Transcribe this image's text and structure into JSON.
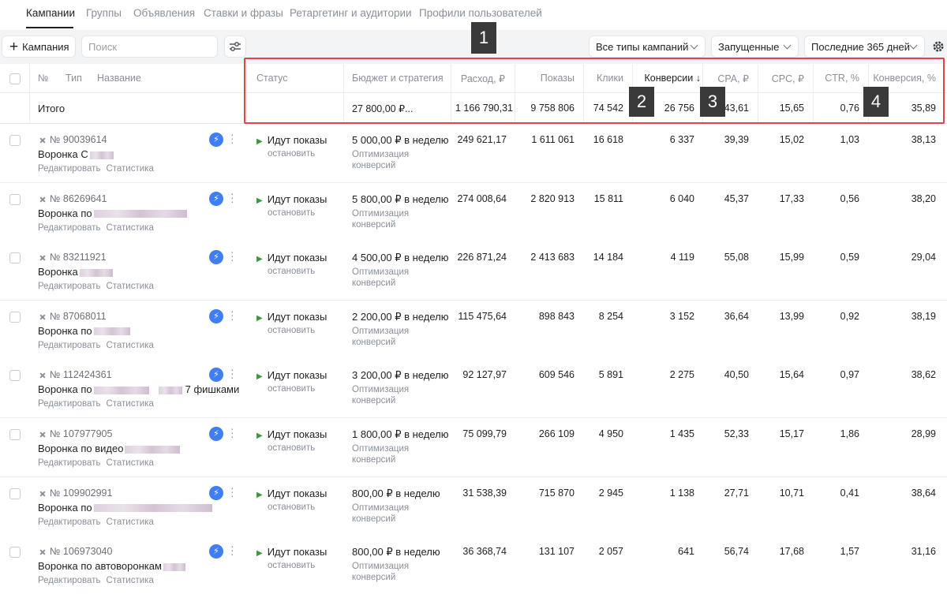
{
  "tabs": [
    "Кампании",
    "Группы",
    "Объявления",
    "Ставки и фразы",
    "Ретаргетинг и аудитории",
    "Профили пользователей"
  ],
  "toolbar": {
    "add_label": "Кампания",
    "search_placeholder": "Поиск",
    "filter_types": "Все типы кампаний",
    "filter_state": "Запущенные",
    "filter_period": "Последние 365 дней"
  },
  "headers": {
    "num": "№",
    "type": "Тип",
    "name": "Название",
    "status": "Статус",
    "budget": "Бюджет и стратегия",
    "spend": "Расход, ₽",
    "impressions": "Показы",
    "clicks": "Клики",
    "conversions": "Конверсии ↓",
    "cpa": "CPA, ₽",
    "cpc": "CPC, ₽",
    "ctr": "CTR, %",
    "conv_rate": "Конверсия, %"
  },
  "total": {
    "label": "Итого",
    "budget": "27 800,00 ₽...",
    "spend": "1 166 790,31",
    "impressions": "9 758 806",
    "clicks": "74 542",
    "conversions": "26 756",
    "cpa": "43,61",
    "cpc": "15,65",
    "ctr": "0,76",
    "conv_rate": "35,89"
  },
  "row_common": {
    "edit": "Редактировать",
    "stats": "Статистика",
    "status": "Идут показы",
    "stop": "остановить",
    "strategy_1": "Оптимизация",
    "strategy_2": "конверсий"
  },
  "rows": [
    {
      "id": "№ 90039614",
      "name": "Воронка С",
      "name_suffix": "",
      "budget": "5 000,00 ₽ в неделю",
      "spend": "249 621,17",
      "impressions": "1 611 061",
      "clicks": "16 618",
      "conversions": "6 337",
      "cpa": "39,39",
      "cpc": "15,02",
      "ctr": "1,03",
      "conv_rate": "38,13"
    },
    {
      "id": "№ 86269641",
      "name": "Воронка по",
      "name_suffix": "",
      "budget": "5 800,00 ₽ в неделю",
      "spend": "274 008,64",
      "impressions": "2 820 913",
      "clicks": "15 811",
      "conversions": "6 040",
      "cpa": "45,37",
      "cpc": "17,33",
      "ctr": "0,56",
      "conv_rate": "38,20"
    },
    {
      "id": "№ 83211921",
      "name": "Воронка",
      "name_suffix": "",
      "budget": "4 500,00 ₽ в неделю",
      "spend": "226 871,24",
      "impressions": "2 413 683",
      "clicks": "14 184",
      "conversions": "4 119",
      "cpa": "55,08",
      "cpc": "15,99",
      "ctr": "0,59",
      "conv_rate": "29,04"
    },
    {
      "id": "№ 87068011",
      "name": "Воронка по",
      "name_suffix": "",
      "budget": "2 200,00 ₽ в неделю",
      "spend": "115 475,64",
      "impressions": "898 843",
      "clicks": "8 254",
      "conversions": "3 152",
      "cpa": "36,64",
      "cpc": "13,99",
      "ctr": "0,92",
      "conv_rate": "38,19"
    },
    {
      "id": "№ 112424361",
      "name": "Воронка по",
      "name_suffix": "7 фишками",
      "budget": "3 200,00 ₽ в неделю",
      "spend": "92 127,97",
      "impressions": "609 546",
      "clicks": "5 891",
      "conversions": "2 275",
      "cpa": "40,50",
      "cpc": "15,64",
      "ctr": "0,97",
      "conv_rate": "38,62"
    },
    {
      "id": "№ 107977905",
      "name": "Воронка по видео",
      "name_suffix": "",
      "budget": "1 800,00 ₽ в неделю",
      "spend": "75 099,79",
      "impressions": "266 109",
      "clicks": "4 950",
      "conversions": "1 435",
      "cpa": "52,33",
      "cpc": "15,17",
      "ctr": "1,86",
      "conv_rate": "28,99"
    },
    {
      "id": "№ 109902991",
      "name": "Воронка по",
      "name_suffix": "",
      "budget": "800,00 ₽ в неделю",
      "spend": "31 538,39",
      "impressions": "715 870",
      "clicks": "2 945",
      "conversions": "1 138",
      "cpa": "27,71",
      "cpc": "10,71",
      "ctr": "0,41",
      "conv_rate": "38,64"
    },
    {
      "id": "№ 106973040",
      "name": "Воронка по автоворонкам",
      "name_suffix": "",
      "budget": "800,00 ₽ в неделю",
      "spend": "36 368,74",
      "impressions": "131 107",
      "clicks": "2 057",
      "conversions": "641",
      "cpa": "56,74",
      "cpc": "17,68",
      "ctr": "1,57",
      "conv_rate": "31,16"
    }
  ],
  "markers": [
    "1",
    "2",
    "3",
    "4"
  ]
}
